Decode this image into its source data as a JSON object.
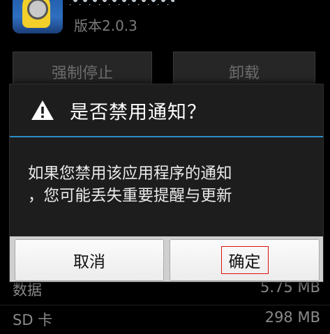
{
  "app": {
    "version": "版本2.0.3"
  },
  "actions": {
    "force_stop": "强制停止",
    "uninstall": "卸载"
  },
  "storage": {
    "rows": [
      {
        "label": "数据",
        "value": "5.75 MB"
      },
      {
        "label": "SD 卡",
        "value": "298 MB"
      }
    ]
  },
  "dialog": {
    "icon": "warning-icon",
    "title": "是否禁用通知？",
    "message": "如果您禁用该应用程序的通知，您可能丢失重要提醒与更新",
    "message_line1": "如果您禁用该应用程序的通知",
    "message_line2": "，您可能丢失重要提醒与更新",
    "cancel_label": "取消",
    "confirm_label": "确定",
    "accent_color": "#2a8ec9",
    "highlight_color": "#dd1111"
  }
}
